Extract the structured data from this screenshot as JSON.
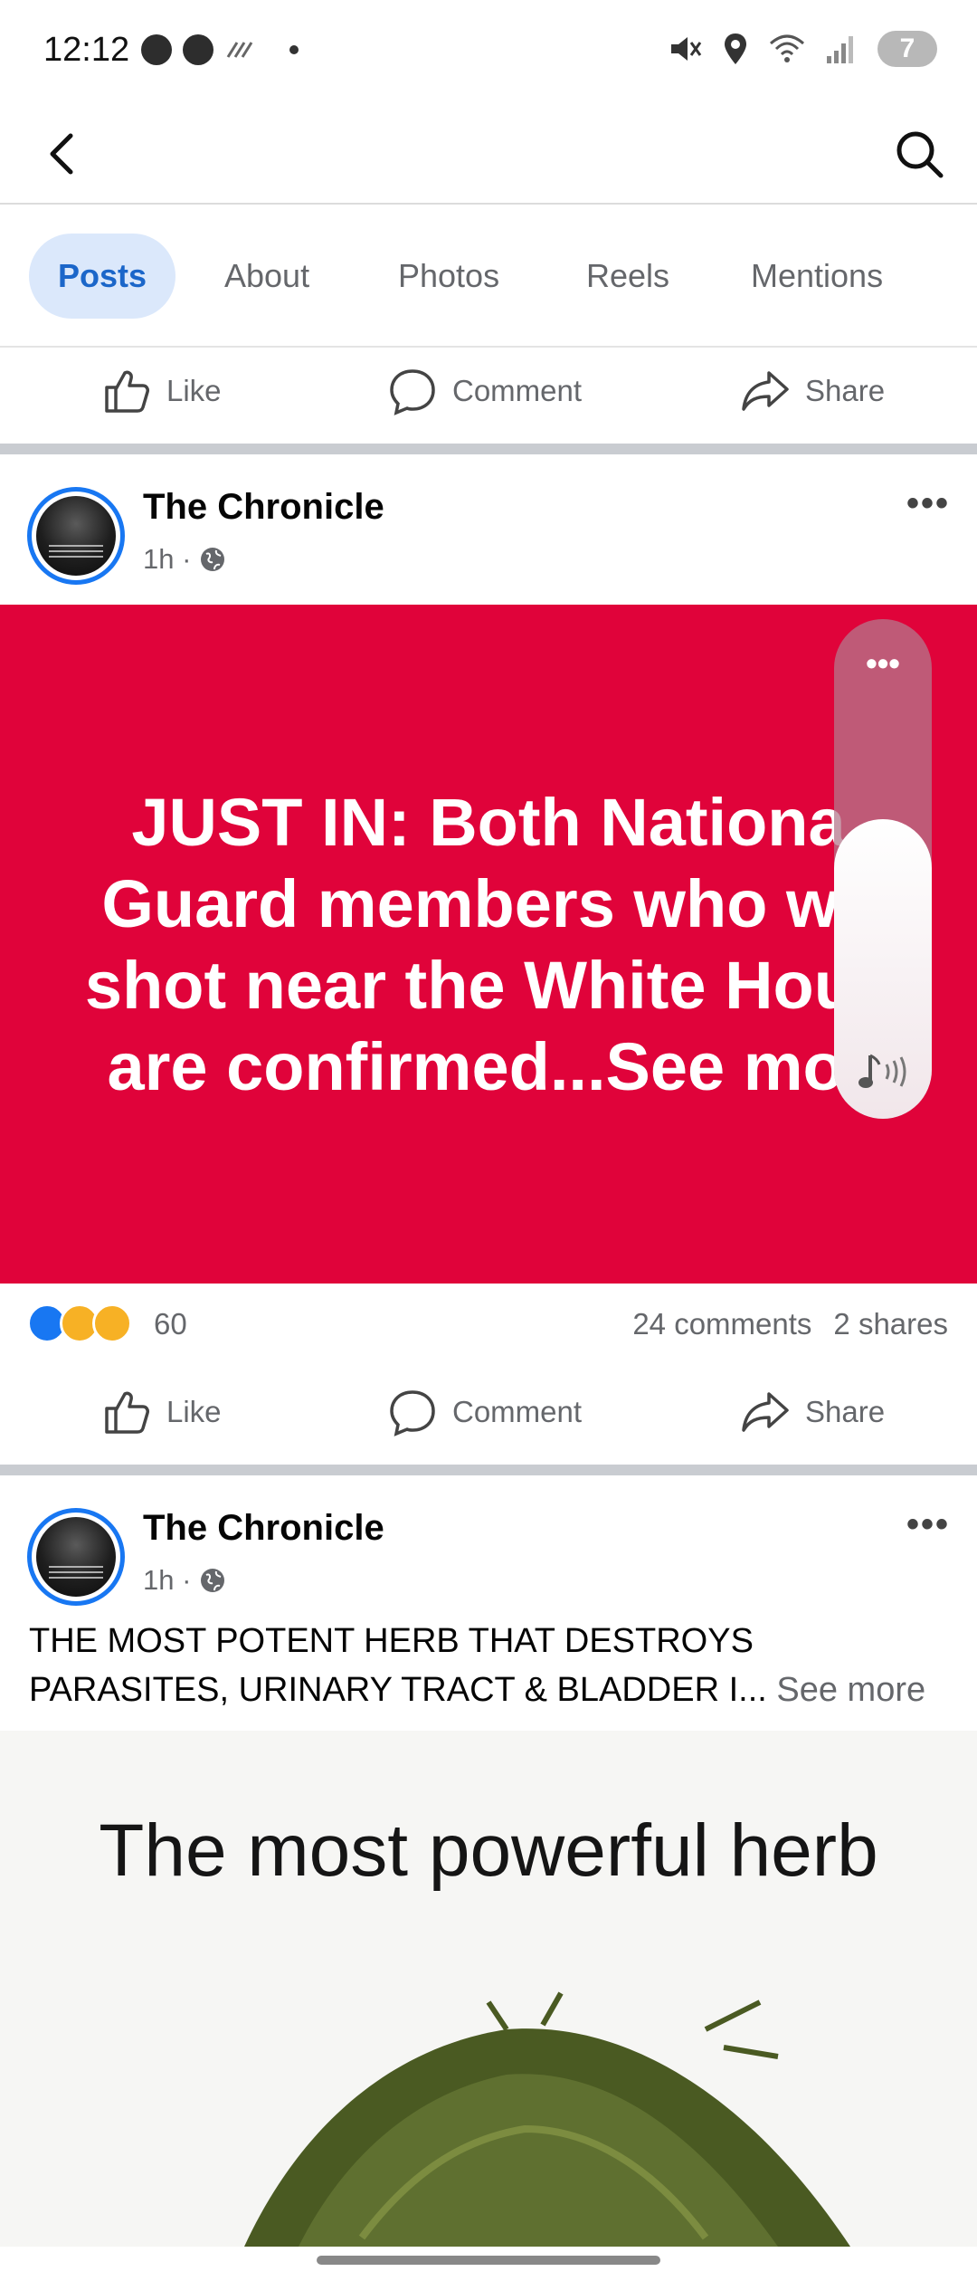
{
  "status": {
    "time": "12:12",
    "battery": "7"
  },
  "tabs": [
    {
      "label": "Posts"
    },
    {
      "label": "About"
    },
    {
      "label": "Photos"
    },
    {
      "label": "Reels"
    },
    {
      "label": "Mentions"
    }
  ],
  "actions": {
    "like": "Like",
    "comment": "Comment",
    "share": "Share"
  },
  "post1": {
    "page_name": "The Chronicle",
    "time": "1h ·",
    "headline": "JUST IN: Both Nationa\nGuard members who we\nshot near the White Hous\nare confirmed...See mor",
    "reaction_count": "60",
    "comments": "24 comments",
    "shares": "2 shares",
    "volume_level": 0.6
  },
  "post2": {
    "page_name": "The Chronicle",
    "time": "1h ·",
    "text": "THE MOST POTENT HERB THAT DESTROYS PARASITES, URINARY TRACT & BLADDER I...",
    "see_more": "See more",
    "image_title": "The most powerful herb"
  },
  "colors": {
    "accent": "#1877f2",
    "red_background": "#e0033a",
    "active_tab_bg": "#dbe8fb"
  }
}
